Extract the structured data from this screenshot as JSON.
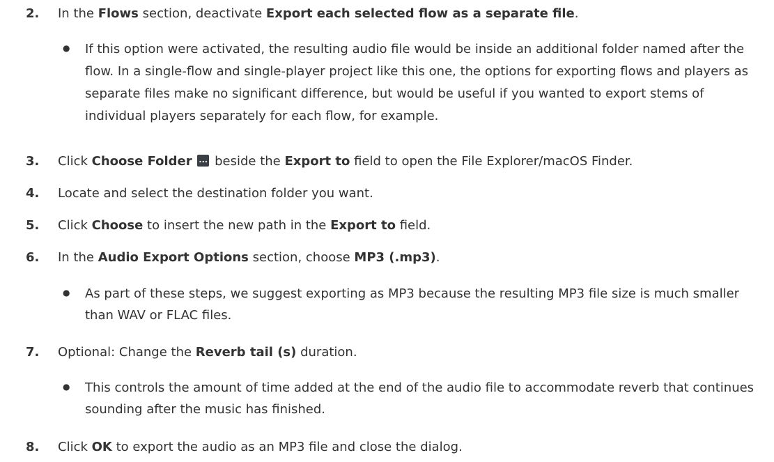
{
  "steps": [
    {
      "num": "2.",
      "parts": [
        "In the ",
        "Flows",
        " section, deactivate ",
        "Export each selected flow as a separate file",
        "."
      ]
    },
    {
      "num": "3.",
      "parts": [
        "Click ",
        "Choose Folder",
        " beside the ",
        "Export to",
        " field to open the File Explorer/macOS Finder."
      ],
      "icon": "ellipsis-icon"
    },
    {
      "num": "4.",
      "parts": [
        "Locate and select the destination folder you want."
      ]
    },
    {
      "num": "5.",
      "parts": [
        "Click ",
        "Choose",
        " to insert the new path in the ",
        "Export to",
        " field."
      ]
    },
    {
      "num": "6.",
      "parts": [
        "In the ",
        "Audio Export Options",
        " section, choose ",
        "MP3 (.mp3)",
        "."
      ]
    },
    {
      "num": "7.",
      "parts": [
        "Optional: Change the ",
        "Reverb tail (s)",
        " duration."
      ]
    },
    {
      "num": "8.",
      "parts": [
        "Click ",
        "OK",
        " to export the audio as an MP3 file and close the dialog."
      ]
    }
  ],
  "bullets": {
    "b1": "If this option were activated, the resulting audio file would be inside an additional folder named after the flow. In a single-flow and single-player project like this one, the options for exporting flows and players as separate files make no significant difference, but would be useful if you wanted to export stems of individual players separately for each flow, for example.",
    "b2": "As part of these steps, we suggest exporting as MP3 because the resulting MP3 file size is much smaller than WAV or FLAC files.",
    "b3": "This controls the amount of time added at the end of the audio file to accommodate reverb that continues sounding after the music has finished.",
    "dot": "●"
  }
}
